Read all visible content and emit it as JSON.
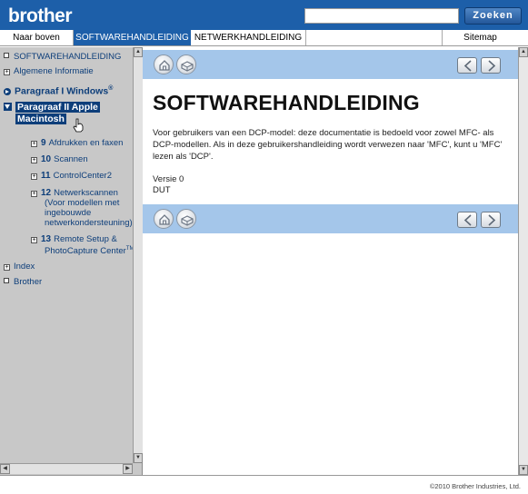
{
  "header": {
    "logo": "brother",
    "search": {
      "value": "",
      "placeholder": ""
    },
    "search_button": "Zoeken",
    "colors": {
      "header_bg": "#1d5fa9",
      "band": "#a4c6ea",
      "sidebar": "#c8c8c8"
    }
  },
  "nav": {
    "top": "Naar boven",
    "software": "SOFTWAREHANDLEIDING",
    "network": "NETWERKHANDLEIDING",
    "sitemap": "Sitemap"
  },
  "sidebar": {
    "item_softwarehandleiding": "SOFTWAREHANDLEIDING",
    "item_algemene": "Algemene Informatie",
    "item_windows": "Paragraaf I Windows",
    "item_windows_sup": "®",
    "item_apple_line1": "Paragraaf II Apple",
    "item_apple_line2": "Macintosh",
    "sub9_num": "9",
    "sub9_label": "Afdrukken en faxen",
    "sub10_num": "10",
    "sub10_label": "Scannen",
    "sub11_num": "11",
    "sub11_label": "ControlCenter2",
    "sub12_num": "12",
    "sub12_line1": "Netwerkscannen",
    "sub12_line2": "(Voor modellen met",
    "sub12_line3": "ingebouwde",
    "sub12_line4": "netwerkondersteuning)",
    "sub13_num": "13",
    "sub13_line1": "Remote Setup &",
    "sub13_line2": "PhotoCapture Center",
    "sub13_tm": "TM",
    "item_index": "Index",
    "item_brother": "Brother"
  },
  "main": {
    "title": "SOFTWAREHANDLEIDING",
    "body": "Voor gebruikers van een DCP-model: deze documentatie is bedoeld voor zowel MFC- als DCP-modellen. Als in deze gebruikershandleiding wordt verwezen naar 'MFC', kunt u 'MFC' lezen als 'DCP'.",
    "version": "Versie 0",
    "language": "DUT"
  },
  "footer": {
    "copyright": "©2010 Brother Industries, Ltd."
  }
}
